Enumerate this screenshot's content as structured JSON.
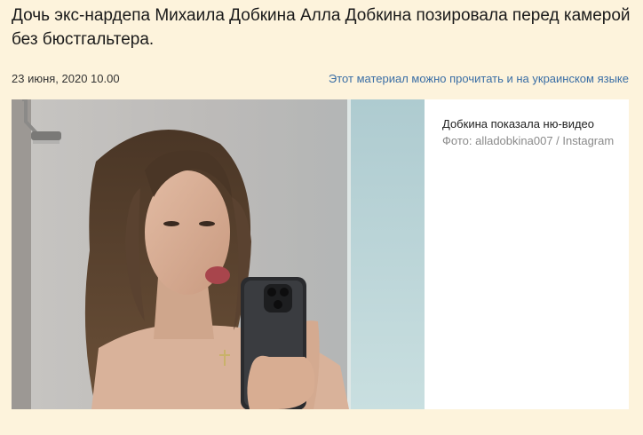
{
  "article": {
    "headline": "Дочь экс-нардепа Михаила Добкина Алла Добкина позировала перед камерой без бюстгальтера.",
    "date": "23 июня, 2020 10.00",
    "language_link": "Этот материал можно прочитать и на украинском языке"
  },
  "figure": {
    "caption": "Добкина показала ню-видео",
    "credit": "Фото: alladobkina007 / Instagram",
    "image_subject": "selfie-photo"
  },
  "colors": {
    "page_background": "#fdf3dc",
    "link": "#3a6ea5",
    "credit": "#8a8a8a"
  }
}
